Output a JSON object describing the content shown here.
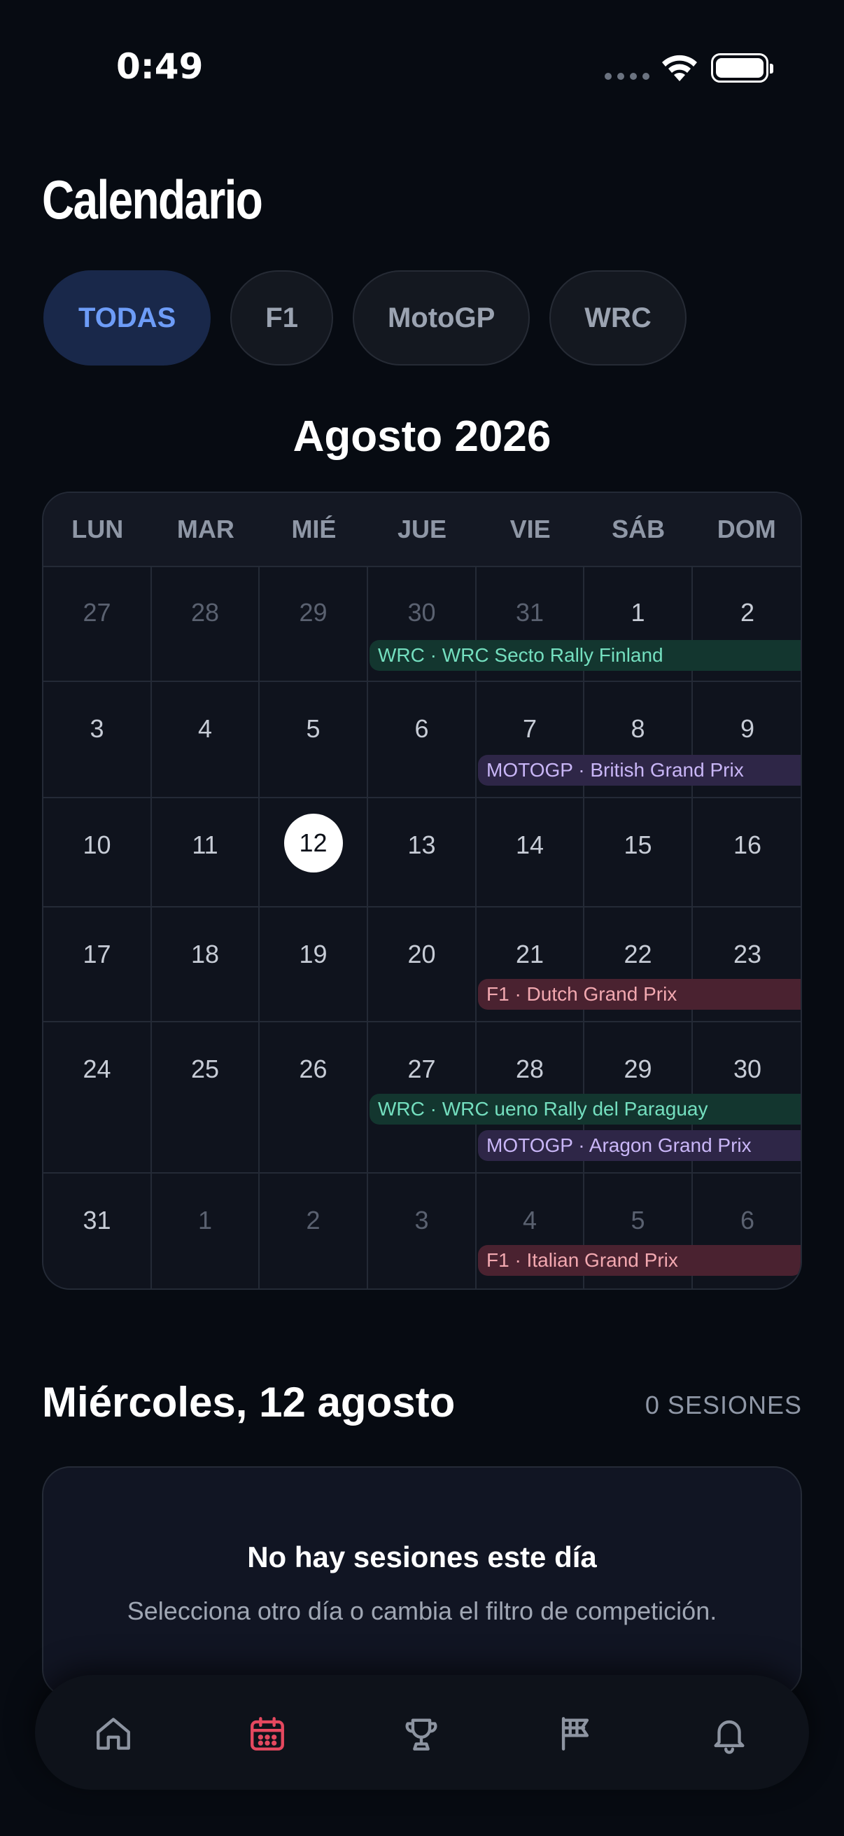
{
  "status_bar": {
    "time": "0:49"
  },
  "header": {
    "title": "Calendario"
  },
  "filters": [
    {
      "label": "TODAS",
      "active": true
    },
    {
      "label": "F1",
      "active": false
    },
    {
      "label": "MotoGP",
      "active": false
    },
    {
      "label": "WRC",
      "active": false
    }
  ],
  "calendar": {
    "month_title": "Agosto 2026",
    "weekdays": [
      "LUN",
      "MAR",
      "MIÉ",
      "JUE",
      "VIE",
      "SÁB",
      "DOM"
    ],
    "weeks": [
      {
        "days": [
          "27",
          "28",
          "29",
          "30",
          "31",
          "1",
          "2"
        ]
      },
      {
        "days": [
          "3",
          "4",
          "5",
          "6",
          "7",
          "8",
          "9"
        ]
      },
      {
        "days": [
          "10",
          "11",
          "12",
          "13",
          "14",
          "15",
          "16"
        ]
      },
      {
        "days": [
          "17",
          "18",
          "19",
          "20",
          "21",
          "22",
          "23"
        ]
      },
      {
        "days": [
          "24",
          "25",
          "26",
          "27",
          "28",
          "29",
          "30"
        ]
      },
      {
        "days": [
          "31",
          "1",
          "2",
          "3",
          "4",
          "5",
          "6"
        ]
      }
    ],
    "selected_day": "12",
    "events": [
      {
        "label": "WRC · WRC Secto Rally Finland",
        "series": "wrc"
      },
      {
        "label": "MOTOGP · British Grand Prix",
        "series": "motogp"
      },
      {
        "label": "F1 · Dutch Grand Prix",
        "series": "f1"
      },
      {
        "label": "WRC · WRC ueno Rally del Paraguay",
        "series": "wrc"
      },
      {
        "label": "MOTOGP · Aragon Grand Prix",
        "series": "motogp"
      },
      {
        "label": "F1 · Italian Grand Prix",
        "series": "f1"
      }
    ]
  },
  "day_detail": {
    "title": "Miércoles, 12 agosto",
    "sessions_count": "0 SESIONES",
    "empty_title": "No hay sesiones este día",
    "empty_subtitle": "Selecciona otro día o cambia el filtro de competición."
  },
  "tabbar": {
    "items": [
      {
        "icon": "home-icon",
        "active": false
      },
      {
        "icon": "calendar-icon",
        "active": true
      },
      {
        "icon": "trophy-icon",
        "active": false
      },
      {
        "icon": "flag-icon",
        "active": false
      },
      {
        "icon": "bell-icon",
        "active": false
      }
    ],
    "active_color": "#e5485f",
    "inactive_color": "#8d94a1"
  },
  "colors": {
    "background": "#070b12",
    "accent_blue": "#6d9cf7",
    "wrc": "#74dfbf",
    "motogp": "#c9b6f7",
    "f1": "#f2a8b0"
  }
}
